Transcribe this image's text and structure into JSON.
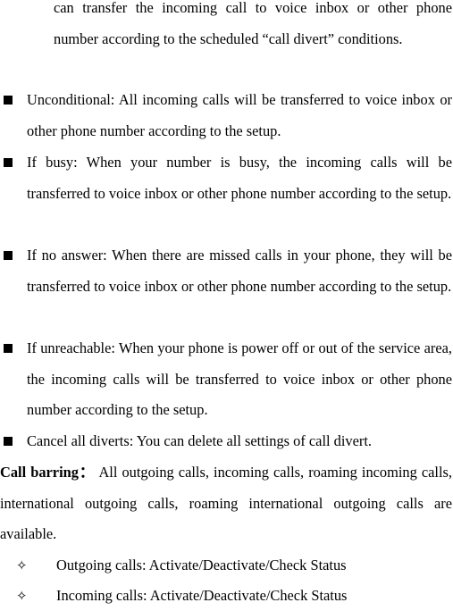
{
  "intro_continuation": "can transfer the incoming call to voice inbox or other phone number according to the scheduled “call divert” conditions.",
  "divert_options": [
    {
      "text": "Unconditional: All incoming calls will be transferred to voice inbox or other phone number according to the setup."
    },
    {
      "text": "If busy: When your number is busy, the incoming calls will be transferred to voice inbox or other phone number according to the setup."
    },
    {
      "text": "If no answer: When there are missed calls in your phone, they will be transferred to voice inbox or other phone number according to the setup."
    },
    {
      "text": "If unreachable: When your phone is power off or out of the service area, the incoming calls will be transferred to voice inbox or other phone number according to the setup."
    },
    {
      "text": "Cancel all diverts: You can delete all settings of call divert."
    }
  ],
  "call_barring": {
    "heading": "Call barring：",
    "text": " All outgoing calls, incoming calls, roaming incoming calls, international outgoing calls, roaming international outgoing calls are available.",
    "sub_items": [
      {
        "bullet": "✧",
        "text": "Outgoing calls: Activate/Deactivate/Check Status"
      },
      {
        "bullet": "✧",
        "text": "Incoming calls: Activate/Deactivate/Check Status"
      }
    ]
  },
  "icons": {
    "square_bullet": "square-bullet-icon",
    "diamond_bullet": "four-point-star-icon"
  }
}
